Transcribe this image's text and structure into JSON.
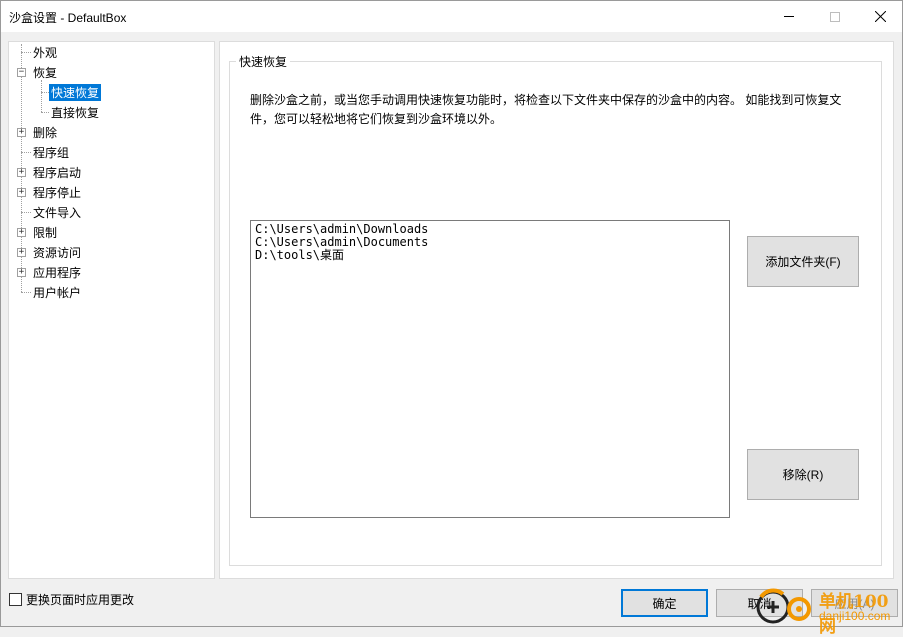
{
  "window": {
    "title": "沙盒设置 - DefaultBox"
  },
  "tree": {
    "items": [
      {
        "label": "外观",
        "expander": ""
      },
      {
        "label": "恢复",
        "expander": "−"
      },
      {
        "label": "快速恢复",
        "expander": ""
      },
      {
        "label": "直接恢复",
        "expander": ""
      },
      {
        "label": "删除",
        "expander": "+"
      },
      {
        "label": "程序组",
        "expander": ""
      },
      {
        "label": "程序启动",
        "expander": "+"
      },
      {
        "label": "程序停止",
        "expander": "+"
      },
      {
        "label": "文件导入",
        "expander": ""
      },
      {
        "label": "限制",
        "expander": "+"
      },
      {
        "label": "资源访问",
        "expander": "+"
      },
      {
        "label": "应用程序",
        "expander": "+"
      },
      {
        "label": "用户帐户",
        "expander": ""
      }
    ],
    "selected": "快速恢复"
  },
  "panel": {
    "group_title": "快速恢复",
    "description": "删除沙盒之前，或当您手动调用快速恢复功能时，将检查以下文件夹中保存的沙盒中的内容。 如能找到可恢复文件，您可以轻松地将它们恢复到沙盒环境以外。",
    "folders": [
      "C:\\Users\\admin\\Downloads",
      "C:\\Users\\admin\\Documents",
      "D:\\tools\\桌面"
    ],
    "add_folder_label": "添加文件夹(F)",
    "remove_label": "移除(R)"
  },
  "footer": {
    "apply_on_change_label": "更换页面时应用更改",
    "apply_on_change_checked": false,
    "ok_label": "确定",
    "cancel_label": "取消",
    "apply_label": "应用(A)"
  },
  "watermark": {
    "line1": "单机100网",
    "line2": "danji100.com"
  }
}
